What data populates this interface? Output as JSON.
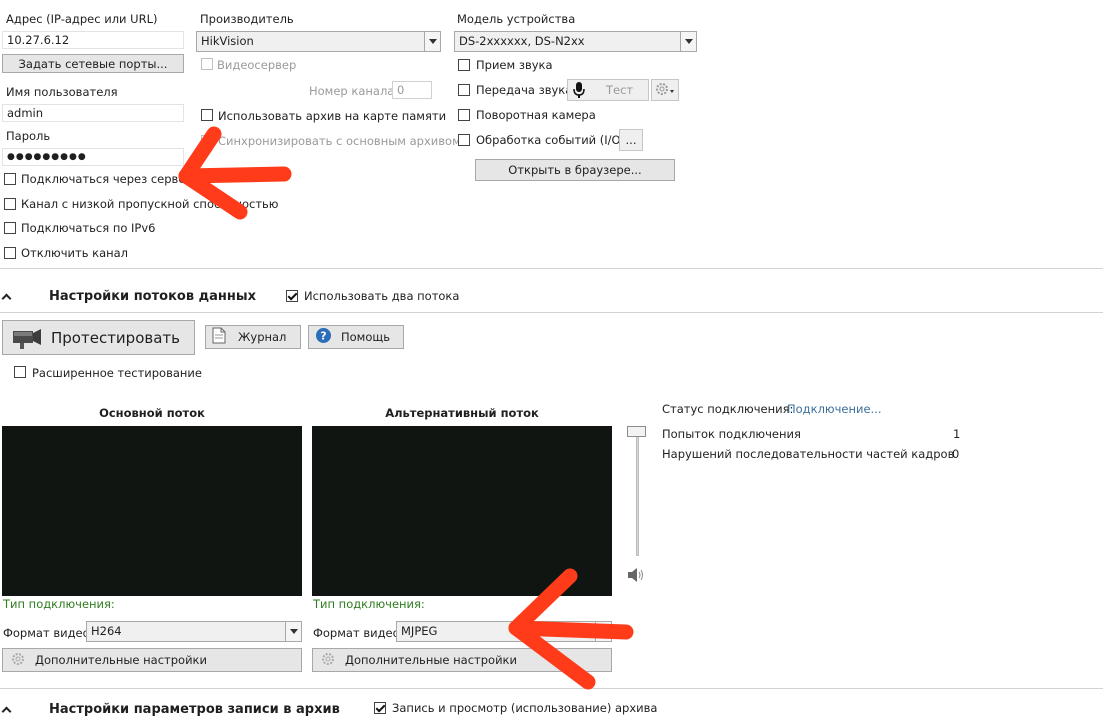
{
  "address": {
    "label": "Адрес (IP-адрес или URL)",
    "value": "10.27.6.12",
    "ports_button": "Задать сетевые порты..."
  },
  "username": {
    "label": "Имя пользователя",
    "value": "admin"
  },
  "password": {
    "label": "Пароль",
    "value": "●●●●●●●●●"
  },
  "left_options": [
    {
      "label": "Подключаться через сервер",
      "checked": false
    },
    {
      "label": "Канал с низкой пропускной способностью",
      "checked": false
    },
    {
      "label": "Подключаться по IPv6",
      "checked": false
    },
    {
      "label": "Отключить канал",
      "checked": false
    }
  ],
  "manufacturer": {
    "label": "Производитель",
    "value": "HikVision",
    "videoserver_label": "Видеосервер",
    "channel_label": "Номер канала",
    "channel_value": "0",
    "archive_card_label": "Использовать архив на карте памяти",
    "sync_label": "Синхронизировать с основным архивом"
  },
  "model": {
    "label": "Модель устройства",
    "value": "DS-2xxxxxx, DS-N2xx",
    "audio_in_label": "Прием звука",
    "audio_out_label": "Передача звука",
    "test_button": "Тест",
    "ptz_label": "Поворотная камера",
    "events_label": "Обработка событий (I/O)",
    "events_button": "...",
    "browser_button": "Открыть в браузере..."
  },
  "streams_section": {
    "title": "Настройки потоков данных",
    "two_streams_label": "Использовать два потока",
    "two_streams_checked": true
  },
  "toolbar": {
    "test_button": "Протестировать",
    "log_button": "Журнал",
    "help_button": "Помощь",
    "extended_test_label": "Расширенное тестирование"
  },
  "main_stream": {
    "title": "Основной поток",
    "connection_type_label": "Тип подключения:",
    "format_label": "Формат видео",
    "format_value": "H264",
    "advanced_button": "Дополнительные настройки"
  },
  "alt_stream": {
    "title": "Альтернативный поток",
    "connection_type_label": "Тип подключения:",
    "format_label": "Формат видео",
    "format_value": "MJPEG",
    "advanced_button": "Дополнительные настройки"
  },
  "status": {
    "connection_label": "Статус подключения:",
    "connection_value": "Подключение...",
    "attempts_label": "Попыток подключения",
    "attempts_value": "1",
    "violations_label": "Нарушений последовательности частей кадров",
    "violations_value": "0"
  },
  "volume": {
    "level": 1.0
  },
  "archive_section": {
    "title": "Настройки параметров записи в архив",
    "record_label": "Запись и просмотр (использование) архива",
    "record_checked": true
  },
  "colors": {
    "annotation_arrow": "#ff3b1a",
    "video_bg": "#111512",
    "connection_type": "#2e7d1e",
    "status_link": "#3c6e9c"
  }
}
